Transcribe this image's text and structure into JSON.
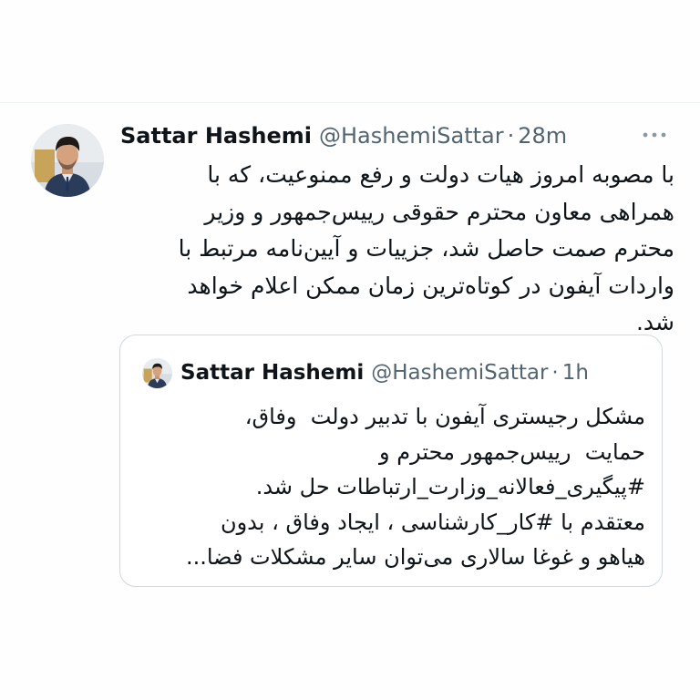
{
  "tweet": {
    "author": {
      "display_name": "Sattar Hashemi",
      "handle": "@HashemiSattar",
      "avatar_icon": "profile-photo"
    },
    "separator": "·",
    "time": "28m",
    "more_icon": "more-horizontal-icon",
    "text": "با مصوبه امروز هیات دولت و رفع ممنوعیت، که با\nهمراهی معاون محترم حقوقی رییس‌جمهور و وزیر\nمحترم صمت حاصل شد، جزییات و آیین‌نامه مرتبط با\nواردات آیفون در کوتاه‌ترین زمان ممکن اعلام خواهد\nشد."
  },
  "quoted_tweet": {
    "author": {
      "display_name": "Sattar Hashemi",
      "handle": "@HashemiSattar",
      "avatar_icon": "profile-photo"
    },
    "separator": "·",
    "time": "1h",
    "text": "مشکل رجیستری آیفون با تدبیر دولت  وفاق،\nحمایت  رییس‌جمهور محترم و\n#پیگیری_فعالانه_وزارت_ارتباطات حل شد.\nمعتقدم با #کار_کارشناسی ، ایجاد وفاق ، بدون\nهیاهو و غوغا سالاری می‌توان سایر مشکلات فضا..."
  },
  "colors": {
    "text_primary": "#0f1419",
    "text_secondary": "#536471",
    "border": "#cfd9de",
    "background": "#ffffff"
  }
}
